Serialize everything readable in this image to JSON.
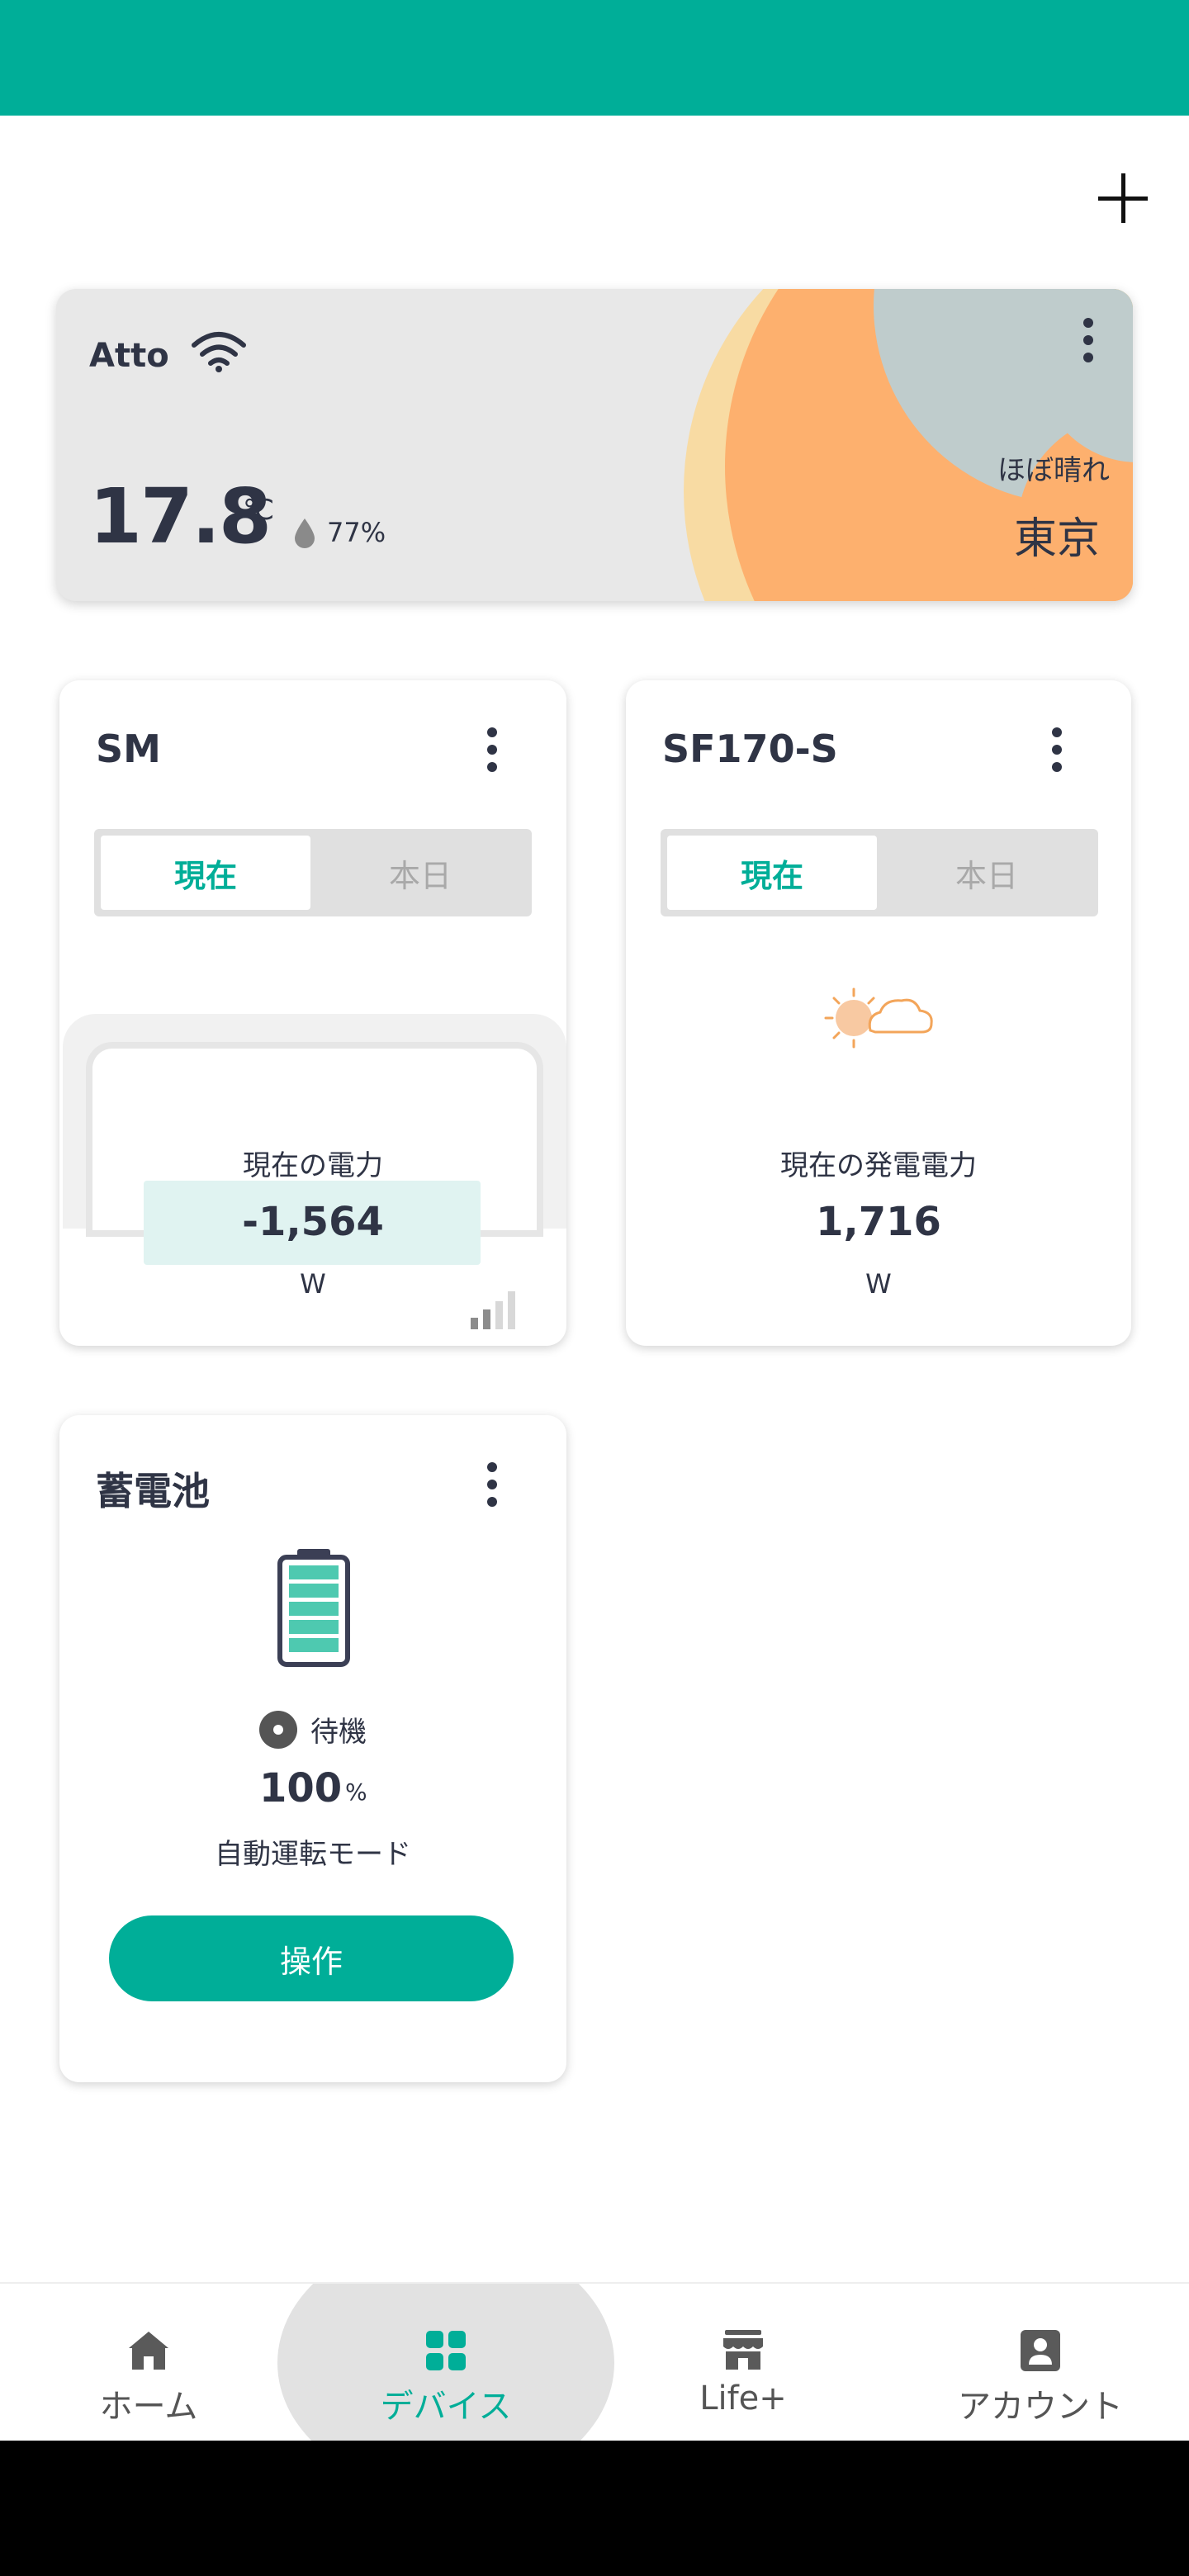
{
  "header": {
    "add_icon": "plus-icon"
  },
  "weather": {
    "device_name": "Atto",
    "temperature": "17.8",
    "temp_unit": "℃",
    "humidity": "77%",
    "condition": "ほぼ晴れ",
    "city": "東京",
    "icons": [
      "wifi-icon",
      "water-drop-icon",
      "more-vert-icon"
    ]
  },
  "cards": {
    "sm": {
      "title": "SM",
      "tabs": [
        "現在",
        "本日"
      ],
      "label": "現在の電力",
      "value": "-1,564",
      "unit": "W"
    },
    "sf": {
      "title": "SF170-S",
      "tabs": [
        "現在",
        "本日"
      ],
      "label": "現在の発電電力",
      "value": "1,716",
      "unit": "W"
    },
    "battery": {
      "title": "蓄電池",
      "status": "待機",
      "percent": "100",
      "percent_unit": "%",
      "mode": "自動運転モード",
      "button": "操作",
      "charge_level": 1.0
    }
  },
  "nav": {
    "items": [
      {
        "label": "ホーム",
        "icon": "home-icon"
      },
      {
        "label": "デバイス",
        "icon": "grid-icon"
      },
      {
        "label": "Life+",
        "icon": "store-icon"
      },
      {
        "label": "アカウント",
        "icon": "account-icon"
      }
    ],
    "active_index": 1
  },
  "colors": {
    "accent": "#00ae98",
    "text": "#2f3445"
  }
}
